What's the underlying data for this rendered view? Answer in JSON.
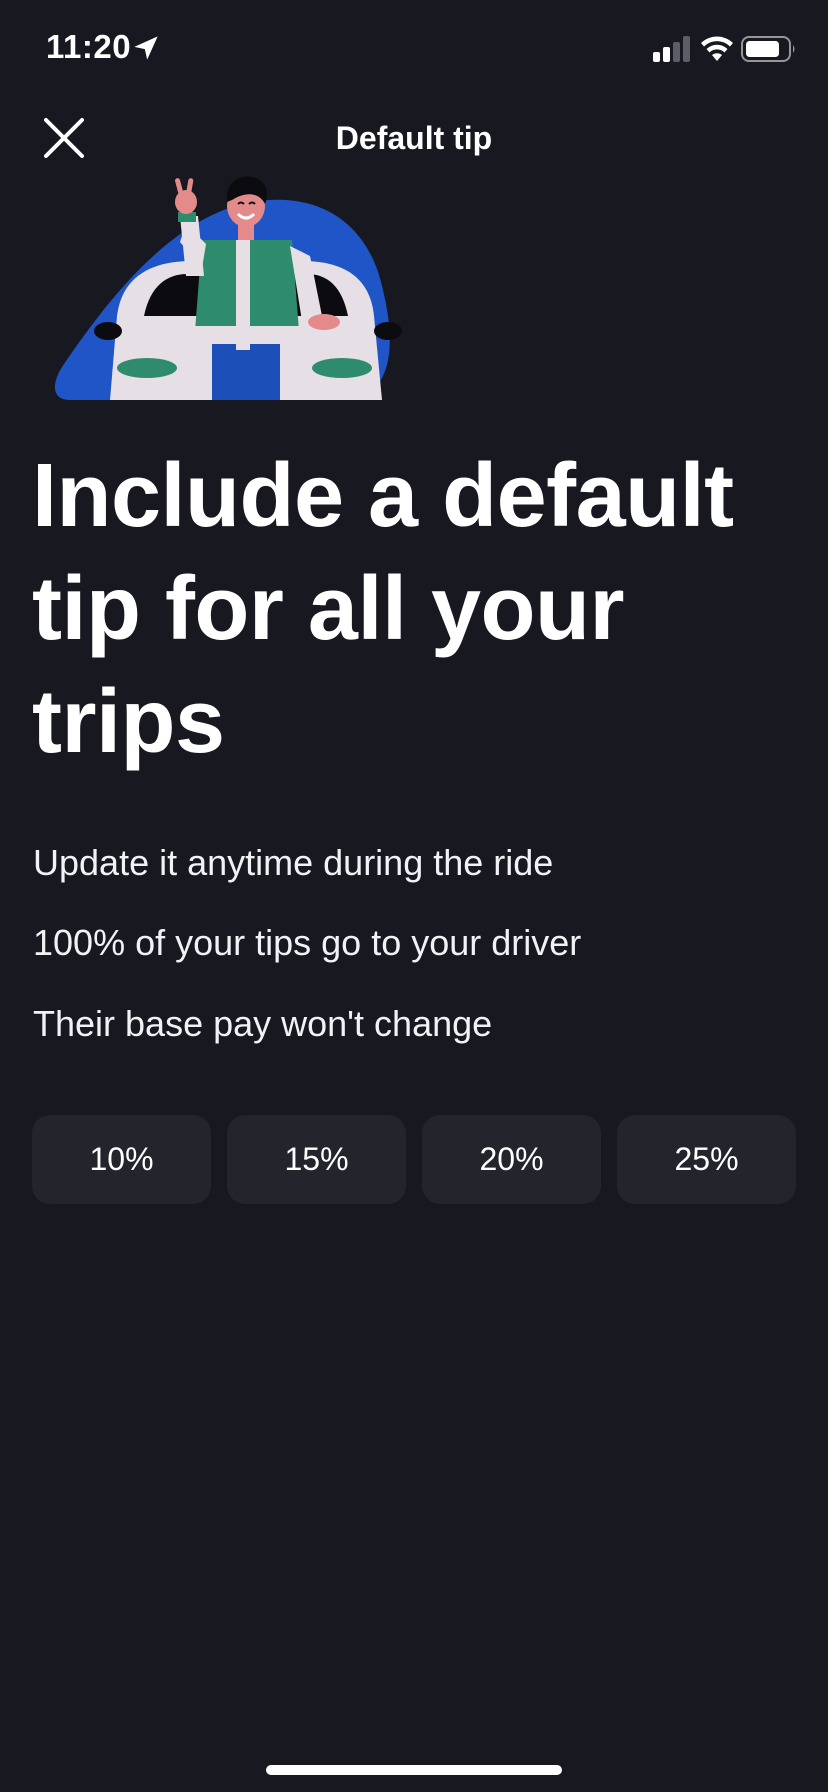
{
  "status_bar": {
    "time": "11:20"
  },
  "header": {
    "title": "Default tip"
  },
  "headline": "Include a default tip for all your trips",
  "info_lines": [
    "Update it anytime during the ride",
    "100% of your tips go to your driver",
    "Their base pay won't change"
  ],
  "tip_options": [
    {
      "label": "10%"
    },
    {
      "label": "15%"
    },
    {
      "label": "20%"
    },
    {
      "label": "25%"
    }
  ],
  "colors": {
    "background": "#171820",
    "option_background": "#23242c",
    "illustration_blue": "#1f55c7",
    "jacket_green": "#2e8b6e"
  },
  "icons": {
    "close": "close-icon",
    "location": "location-arrow-icon",
    "signal": "cellular-signal-icon",
    "wifi": "wifi-icon",
    "battery": "battery-icon"
  }
}
